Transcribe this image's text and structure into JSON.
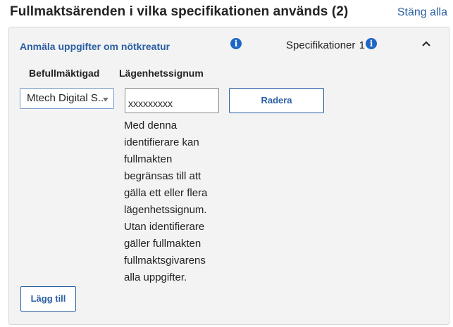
{
  "header": {
    "title": "Fullmaktsärenden i vilka specifikationen används (2)",
    "close_all_label": "Stäng alla"
  },
  "panel": {
    "case_title": "Anmäla uppgifter om nötkreatur",
    "specifications_label": "Specifikationer",
    "specifications_count": "1",
    "columns": {
      "agent_label": "Befullmäktigad",
      "apartment_label": "Lägenhetssignum"
    },
    "agent_select": {
      "selected": "Mtech Digital S..."
    },
    "apartment_input": {
      "value": "xxxxxxxxx"
    },
    "delete_label": "Radera",
    "help_text": "Med denna identifierare kan fullmakten begränsas till att gälla ett eller flera lägenhetssignum. Utan identifierare gäller fullmakten fullmaktsgivarens alla uppgifter.",
    "add_label": "Lägg till"
  },
  "icons": [
    "info-icon",
    "chevron-up-icon",
    "dropdown-arrow-icon"
  ],
  "colors": {
    "link": "#2b5fa3",
    "info_icon": "#1f66c4",
    "panel_bg": "#f3f3f3",
    "border": "#d6d6d6"
  }
}
